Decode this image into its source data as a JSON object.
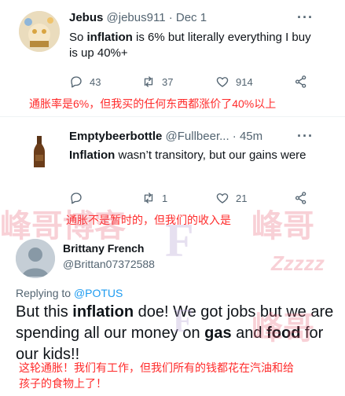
{
  "tweet1": {
    "name": "Jebus",
    "handle": "@jebus911",
    "dot": "·",
    "time": "Dec 1",
    "text_prefix": "So ",
    "text_bold": "inflation",
    "text_suffix": " is 6% but literally everything I buy is up 40%+",
    "reply_count": "43",
    "retweet_count": "37",
    "like_count": "914"
  },
  "caption1": "通胀率是6%，但我买的任何东西都涨价了40%以上",
  "tweet2": {
    "name": "Emptybeerbottle",
    "handle": "@Fullbeer...",
    "dot": "·",
    "time": "45m",
    "text_bold": "Inflation",
    "text_suffix": " wasn’t transitory, but our gains were",
    "reply_count": "",
    "retweet_count": "1",
    "like_count": "21"
  },
  "caption2": "通胀不是暂时的，但我们的收入是",
  "tweet3": {
    "name": "Brittany French",
    "handle": "@Brittan07372588",
    "replying_prefix": "Replying to ",
    "replying_mention": "@POTUS",
    "t_a": "But this ",
    "t_b": "inflation",
    "t_c": " doe! We got jobs but we are spending all our money on ",
    "t_d": "gas",
    "t_e": " and ",
    "t_f": "food",
    "t_g": " for our kids!!"
  },
  "caption3_line1": "这轮通胀！我们有工作，但我们所有的钱都花在汽油和给",
  "caption3_line2": "孩子的食物上了！",
  "watermark": {
    "text_a": "峰哥博客",
    "text_b": "峰哥",
    "text_c": "峰哥",
    "text_d": "Zzzzz",
    "text_e": "F",
    "text_f": "F"
  },
  "icons": {
    "reply": "reply-icon",
    "retweet": "retweet-icon",
    "like": "heart-icon",
    "share": "share-icon",
    "more": "more-icon"
  },
  "colors": {
    "caption_red": "#ff2b2b",
    "secondary_text": "#536471",
    "link_blue": "#1d9bf0"
  }
}
